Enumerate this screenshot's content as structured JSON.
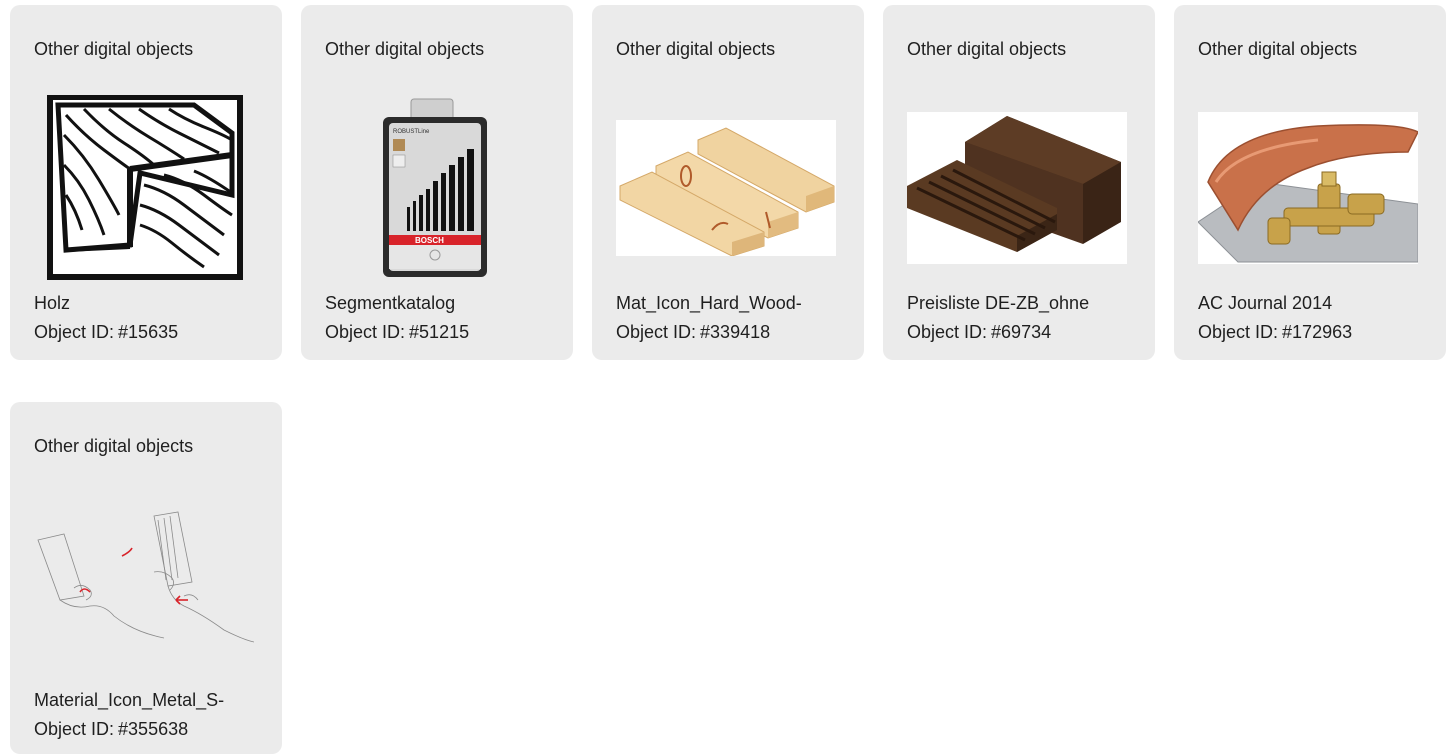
{
  "object_id_prefix": "Object ID:",
  "cards": [
    {
      "category": "Other digital objects",
      "name": "Holz",
      "object_id": "#15635",
      "icon": "wood-grain-icon"
    },
    {
      "category": "Other digital objects",
      "name": "Segmentkatalog",
      "object_id": "#51215",
      "icon": "drill-bit-set-image",
      "brand": "BOSCH",
      "pack_label": "ROBUSTLine"
    },
    {
      "category": "Other digital objects",
      "name": "Mat_Icon_Hard_Wood-",
      "object_id": "#339418",
      "icon": "wooden-planks-image"
    },
    {
      "category": "Other digital objects",
      "name": "Preisliste DE-ZB_ohne",
      "object_id": "#69734",
      "icon": "dark-wood-blocks-image"
    },
    {
      "category": "Other digital objects",
      "name": "AC Journal 2014",
      "object_id": "#172963",
      "icon": "copper-gutter-fitting-image"
    },
    {
      "category": "Other digital objects",
      "name": "Material_Icon_Metal_S-",
      "object_id": "#355638",
      "icon": "hands-sketch-image"
    }
  ],
  "colors": {
    "card_bg": "#ebebeb",
    "text": "#1f1f1f",
    "accent_red": "#d8232a"
  }
}
